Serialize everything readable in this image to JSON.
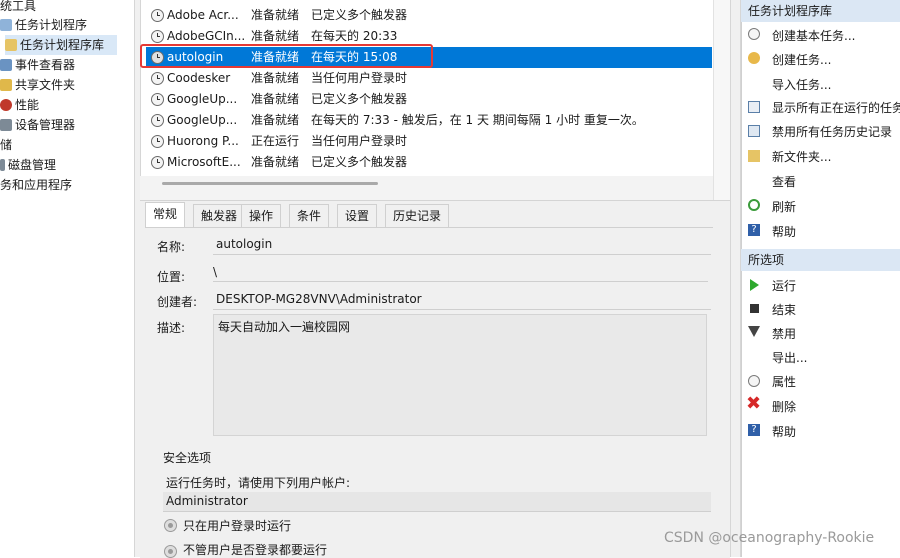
{
  "tree": [
    {
      "label": "统工具"
    },
    {
      "label": "任务计划程序"
    },
    {
      "label": "任务计划程序库",
      "selected": true
    },
    {
      "label": "事件查看器"
    },
    {
      "label": "共享文件夹"
    },
    {
      "label": "性能"
    },
    {
      "label": "设备管理器"
    },
    {
      "label": "储"
    },
    {
      "label": "磁盘管理"
    },
    {
      "label": "务和应用程序"
    }
  ],
  "tasks": [
    {
      "name": "Adobe Acr...",
      "status": "准备就绪",
      "trigger": "已定义多个触发器"
    },
    {
      "name": "AdobeGCIn...",
      "status": "准备就绪",
      "trigger": "在每天的 20:33"
    },
    {
      "name": "autologin",
      "status": "准备就绪",
      "trigger": "在每天的 15:08",
      "selected": true
    },
    {
      "name": "Coodesker",
      "status": "准备就绪",
      "trigger": "当任何用户登录时"
    },
    {
      "name": "GoogleUp...",
      "status": "准备就绪",
      "trigger": "已定义多个触发器"
    },
    {
      "name": "GoogleUp...",
      "status": "准备就绪",
      "trigger": "在每天的 7:33 - 触发后，在 1 天 期间每隔 1 小时 重复一次。"
    },
    {
      "name": "Huorong P...",
      "status": "正在运行",
      "trigger": "当任何用户登录时"
    },
    {
      "name": "MicrosoftE...",
      "status": "准备就绪",
      "trigger": "已定义多个触发器"
    }
  ],
  "tabs": [
    "常规",
    "触发器",
    "操作",
    "条件",
    "设置",
    "历史记录"
  ],
  "detail": {
    "name_label": "名称:",
    "name_value": "autologin",
    "location_label": "位置:",
    "location_value": "\\",
    "author_label": "创建者:",
    "author_value": "DESKTOP-MG28VNV\\Administrator",
    "desc_label": "描述:",
    "desc_value": "每天自动加入一遍校园网",
    "security_title": "安全选项",
    "run_as_label": "运行任务时，请使用下列用户帐户:",
    "run_as_value": "Administrator",
    "radio1": "只在用户登录时运行",
    "radio2": "不管用户是否登录都要运行"
  },
  "actions_lib": {
    "header": "任务计划程序库",
    "items": [
      {
        "label": "创建基本任务...",
        "icon": "create-basic-task-icon"
      },
      {
        "label": "创建任务...",
        "icon": "create-task-icon"
      },
      {
        "label": "导入任务...",
        "icon": ""
      },
      {
        "label": "显示所有正在运行的任务",
        "icon": "running-tasks-icon"
      },
      {
        "label": "禁用所有任务历史记录",
        "icon": "history-icon"
      },
      {
        "label": "新文件夹...",
        "icon": "folder-icon"
      },
      {
        "label": "查看",
        "icon": ""
      },
      {
        "label": "刷新",
        "icon": "refresh-icon"
      },
      {
        "label": "帮助",
        "icon": "help-icon"
      }
    ]
  },
  "actions_sel": {
    "header": "所选项",
    "items": [
      {
        "label": "运行",
        "icon": "run-icon"
      },
      {
        "label": "结束",
        "icon": "end-icon"
      },
      {
        "label": "禁用",
        "icon": "disable-icon"
      },
      {
        "label": "导出...",
        "icon": ""
      },
      {
        "label": "属性",
        "icon": "properties-icon"
      },
      {
        "label": "删除",
        "icon": "delete-icon"
      },
      {
        "label": "帮助",
        "icon": "help-icon"
      }
    ]
  },
  "watermark": "CSDN @oceanography-Rookie",
  "colors": {
    "selection": "#0078d7",
    "highlight_box": "#e53935",
    "section_header": "#dbe7f4"
  }
}
